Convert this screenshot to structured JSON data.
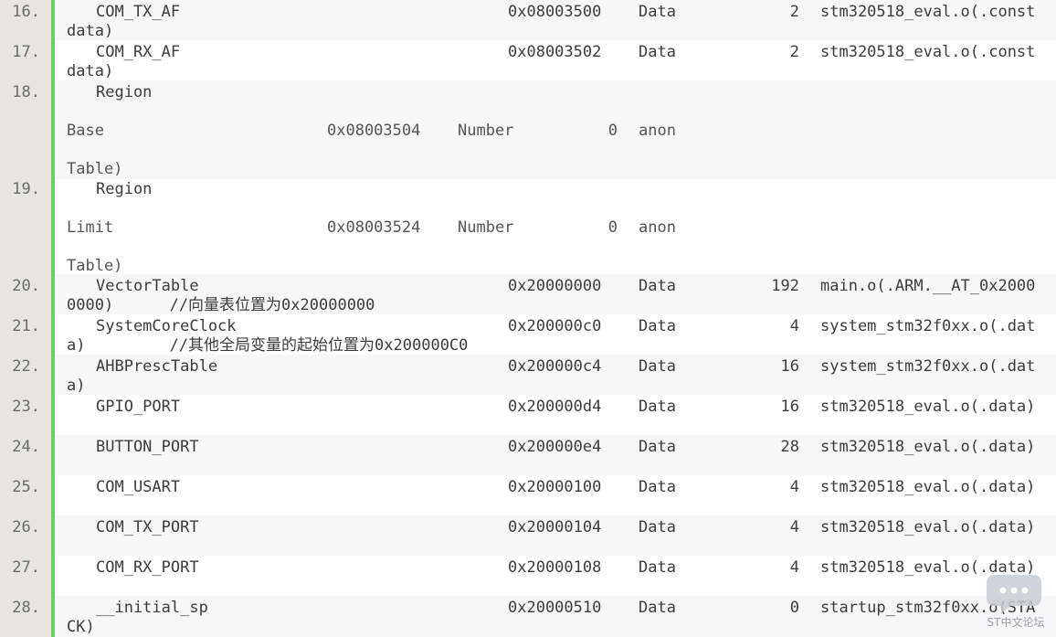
{
  "lines": [
    {
      "num": "16.",
      "name": "COM_TX_AF",
      "addr": "0x08003500",
      "type": "Data",
      "size": "2",
      "obj": "stm320518_eval.o(.const",
      "wrap": "data)"
    },
    {
      "num": "17.",
      "name": "COM_RX_AF",
      "addr": "0x08003502",
      "type": "Data",
      "size": "2",
      "obj": "stm320518_eval.o(.const",
      "wrap": "data)"
    },
    {
      "num": "18.",
      "name": "Region",
      "r_label": "Base",
      "r_addr": "0x08003504",
      "r_type": "Number",
      "r_size": "0",
      "r_obj": "anon",
      "wrap": "Table)"
    },
    {
      "num": "19.",
      "name": "Region",
      "r_label": "Limit",
      "r_addr": "0x08003524",
      "r_type": "Number",
      "r_size": "0",
      "r_obj": "anon",
      "wrap": "Table)"
    },
    {
      "num": "20.",
      "name": "VectorTable",
      "addr": "0x20000000",
      "type": "Data",
      "size": "192",
      "obj": "main.o(.ARM.__AT_0x2000",
      "wrap": "0000)      //向量表位置为0x20000000"
    },
    {
      "num": "21.",
      "name": "SystemCoreClock",
      "addr": "0x200000c0",
      "type": "Data",
      "size": "4",
      "obj": "system_stm32f0xx.o(.dat",
      "wrap": "a)         //其他全局变量的起始位置为0x200000C0"
    },
    {
      "num": "22.",
      "name": "AHBPrescTable",
      "addr": "0x200000c4",
      "type": "Data",
      "size": "16",
      "obj": "system_stm32f0xx.o(.dat",
      "wrap": "a)"
    },
    {
      "num": "23.",
      "name": "GPIO_PORT",
      "addr": "0x200000d4",
      "type": "Data",
      "size": "16",
      "obj": "stm320518_eval.o(.data)"
    },
    {
      "num": "24.",
      "name": "BUTTON_PORT",
      "addr": "0x200000e4",
      "type": "Data",
      "size": "28",
      "obj": "stm320518_eval.o(.data)"
    },
    {
      "num": "25.",
      "name": "COM_USART",
      "addr": "0x20000100",
      "type": "Data",
      "size": "4",
      "obj": "stm320518_eval.o(.data)"
    },
    {
      "num": "26.",
      "name": "COM_TX_PORT",
      "addr": "0x20000104",
      "type": "Data",
      "size": "4",
      "obj": "stm320518_eval.o(.data)"
    },
    {
      "num": "27.",
      "name": "COM_RX_PORT",
      "addr": "0x20000108",
      "type": "Data",
      "size": "4",
      "obj": "stm320518_eval.o(.data)"
    },
    {
      "num": "28.",
      "name": "__initial_sp",
      "addr": "0x20000510",
      "type": "Data",
      "size": "0",
      "obj": "startup_stm32f0xx.o(STA",
      "wrap": "CK)"
    }
  ],
  "watermark": {
    "text": "ST中文论坛",
    "icon": "chat-bubble-icon"
  }
}
